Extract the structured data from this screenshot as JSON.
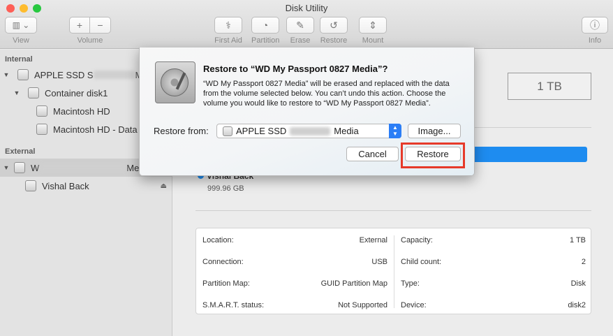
{
  "window": {
    "title": "Disk Utility",
    "traffic_lights": [
      "#fe5f57",
      "#febc2e",
      "#28c840"
    ]
  },
  "toolbar": {
    "view_label": "View",
    "volume_label": "Volume",
    "first_aid_label": "First Aid",
    "partition_label": "Partition",
    "erase_label": "Erase",
    "restore_label": "Restore",
    "mount_label": "Mount",
    "info_label": "Info"
  },
  "sidebar": {
    "internal_header": "Internal",
    "external_header": "External",
    "items": [
      {
        "label_start": "APPLE SSD S",
        "label_end": "Me"
      },
      {
        "label": "Container disk1"
      },
      {
        "label": "Macintosh HD"
      },
      {
        "label": "Macintosh HD - Data"
      },
      {
        "label_start": "W",
        "label_end": "Me"
      },
      {
        "label": "Vishal Back"
      }
    ]
  },
  "main": {
    "disk_capacity": "1 TB",
    "volume_name": "Vishal Back",
    "volume_size": "999.96 GB",
    "info_left": [
      {
        "label": "Location:",
        "value": "External"
      },
      {
        "label": "Connection:",
        "value": "USB"
      },
      {
        "label": "Partition Map:",
        "value": "GUID Partition Map"
      },
      {
        "label": "S.M.A.R.T. status:",
        "value": "Not Supported"
      }
    ],
    "info_right": [
      {
        "label": "Capacity:",
        "value": "1 TB"
      },
      {
        "label": "Child count:",
        "value": "2"
      },
      {
        "label": "Type:",
        "value": "Disk"
      },
      {
        "label": "Device:",
        "value": "disk2"
      }
    ]
  },
  "dialog": {
    "title": "Restore to “WD My Passport 0827 Media”?",
    "message": "“WD My Passport 0827 Media” will be erased and replaced with the data from the volume selected below. You can’t undo this action. Choose the volume you would like to restore to “WD My Passport 0827 Media”.",
    "restore_from_label": "Restore from:",
    "source_start": "APPLE SSD",
    "source_end": "Media",
    "image_button": "Image...",
    "cancel_button": "Cancel",
    "restore_button": "Restore",
    "highlight_color": "#e63a2a"
  }
}
